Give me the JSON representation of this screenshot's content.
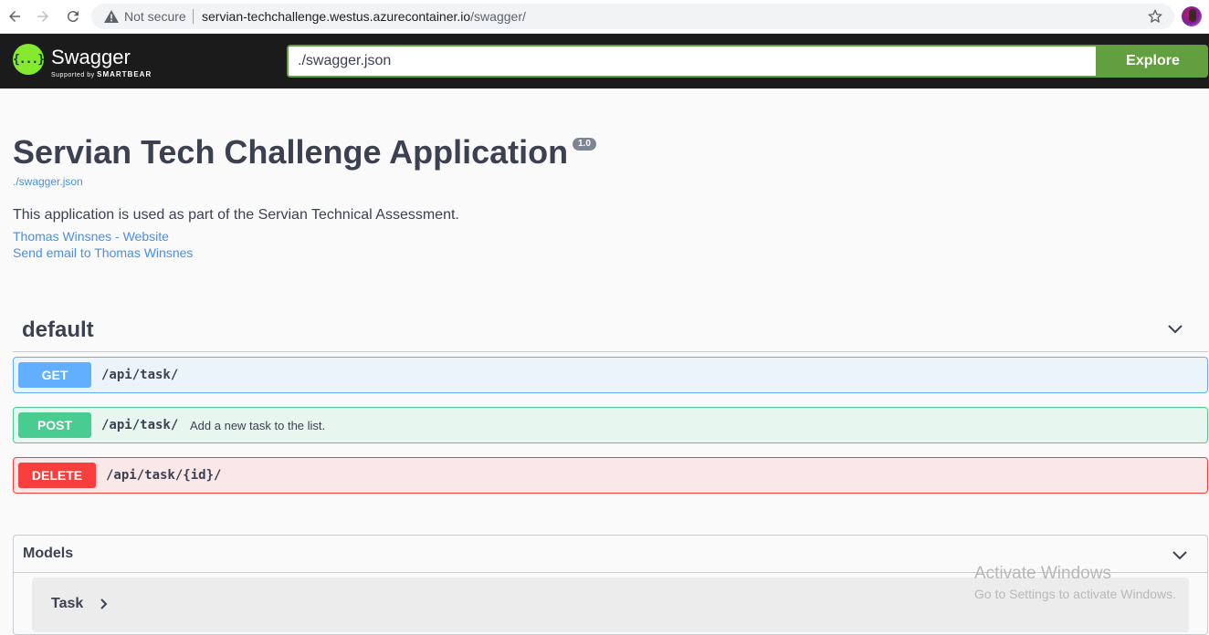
{
  "browser": {
    "security_label": "Not secure",
    "url_host": "servian-techchallenge.westus.azurecontainer.io",
    "url_path": "/swagger/"
  },
  "topbar": {
    "brand": "Swagger",
    "brand_sub_prefix": "Supported by",
    "brand_sub_company": "SMARTBEAR",
    "logo_glyph": "{...}",
    "spec_url_value": "./swagger.json",
    "explore_label": "Explore",
    "accent_color": "#62a03f"
  },
  "info": {
    "title": "Servian Tech Challenge Application",
    "version": "1.0",
    "spec_link": "./swagger.json",
    "description": "This application is used as part of the Servian Technical Assessment.",
    "contact_website": "Thomas Winsnes - Website",
    "contact_email": "Send email to Thomas Winsnes"
  },
  "operations": {
    "tag": "default",
    "items": [
      {
        "method": "GET",
        "path": "/api/task/",
        "summary": "",
        "color": "#61affe"
      },
      {
        "method": "POST",
        "path": "/api/task/",
        "summary": "Add a new task to the list.",
        "color": "#49cc90"
      },
      {
        "method": "DELETE",
        "path": "/api/task/{id}/",
        "summary": "",
        "color": "#f93e3e"
      }
    ]
  },
  "models": {
    "title": "Models",
    "items": [
      {
        "name": "Task"
      }
    ]
  },
  "watermark": {
    "title": "Activate Windows",
    "subtitle": "Go to Settings to activate Windows."
  }
}
